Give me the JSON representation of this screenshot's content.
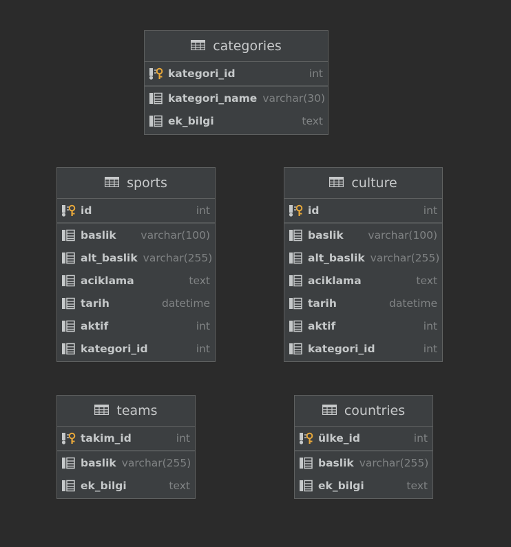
{
  "tables": {
    "categories": {
      "name": "categories",
      "pk": [
        {
          "name": "kategori_id",
          "type": "int"
        }
      ],
      "columns": [
        {
          "name": "kategori_name",
          "type": "varchar(30)"
        },
        {
          "name": "ek_bilgi",
          "type": "text"
        }
      ]
    },
    "sports": {
      "name": "sports",
      "pk": [
        {
          "name": "id",
          "type": "int"
        }
      ],
      "columns": [
        {
          "name": "baslik",
          "type": "varchar(100)"
        },
        {
          "name": "alt_baslik",
          "type": "varchar(255)"
        },
        {
          "name": "aciklama",
          "type": "text"
        },
        {
          "name": "tarih",
          "type": "datetime"
        },
        {
          "name": "aktif",
          "type": "int"
        },
        {
          "name": "kategori_id",
          "type": "int"
        }
      ]
    },
    "culture": {
      "name": "culture",
      "pk": [
        {
          "name": "id",
          "type": "int"
        }
      ],
      "columns": [
        {
          "name": "baslik",
          "type": "varchar(100)"
        },
        {
          "name": "alt_baslik",
          "type": "varchar(255)"
        },
        {
          "name": "aciklama",
          "type": "text"
        },
        {
          "name": "tarih",
          "type": "datetime"
        },
        {
          "name": "aktif",
          "type": "int"
        },
        {
          "name": "kategori_id",
          "type": "int"
        }
      ]
    },
    "teams": {
      "name": "teams",
      "pk": [
        {
          "name": "takim_id",
          "type": "int"
        }
      ],
      "columns": [
        {
          "name": "baslik",
          "type": "varchar(255)"
        },
        {
          "name": "ek_bilgi",
          "type": "text"
        }
      ]
    },
    "countries": {
      "name": "countries",
      "pk": [
        {
          "name": "ülke_id",
          "type": "int"
        }
      ],
      "columns": [
        {
          "name": "baslik",
          "type": "varchar(255)"
        },
        {
          "name": "ek_bilgi",
          "type": "text"
        }
      ]
    }
  },
  "icons": {
    "table": "table-icon",
    "primary_key_column": "primary-key-column-icon",
    "column": "column-icon"
  },
  "colors": {
    "background": "#2b2b2b",
    "table_fill": "#3c3f41",
    "key": "#e8a83a"
  }
}
